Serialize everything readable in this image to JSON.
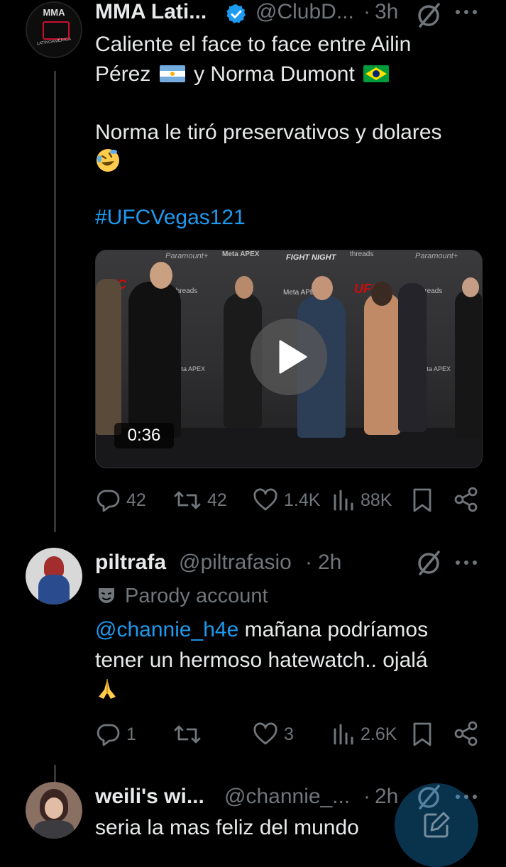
{
  "tweet1": {
    "avatar_text": {
      "top": "MMA",
      "bottom": "LATINOAMÉRICA"
    },
    "name": "MMA Lati...",
    "handle": "@ClubD...",
    "separator": "·",
    "time": "3h",
    "text": {
      "line1": "Caliente el face to face entre Ailin",
      "line2a": "Pérez",
      "line2b": "y Norma Dumont",
      "line3": "Norma le tiró preservativos y dolares",
      "hashtag": "#UFCVegas121"
    },
    "video": {
      "duration": "0:36",
      "bg_text": {
        "paramount": "Paramount+",
        "meta_apex": "Meta APEX",
        "fight_night": "FIGHT NIGHT",
        "threads": "threads",
        "ufc": "UFC"
      }
    },
    "actions": {
      "replies": "42",
      "reposts": "42",
      "likes": "1.4K",
      "views": "88K"
    }
  },
  "tweet2": {
    "name": "piltrafa",
    "handle": "@piltrafasio",
    "separator": "·",
    "time": "2h",
    "parody_label": "Parody account",
    "text": {
      "mention": "@channie_h4e",
      "line1_rest": " mañana podríamos",
      "line2": "tener un hermoso hatewatch.. ojalá"
    },
    "actions": {
      "replies": "1",
      "reposts": "",
      "likes": "3",
      "views": "2.6K"
    }
  },
  "tweet3": {
    "name": "weili's wi...",
    "handle": "@channie_...",
    "separator": "·",
    "time": "2h",
    "text": "seria la mas feliz del mundo"
  },
  "colors": {
    "background": "#000000",
    "text": "#e7e9ea",
    "muted": "#71767b",
    "link": "#1d9bf0",
    "verified": "#1d9bf0",
    "fab": "#1d9bf0"
  }
}
